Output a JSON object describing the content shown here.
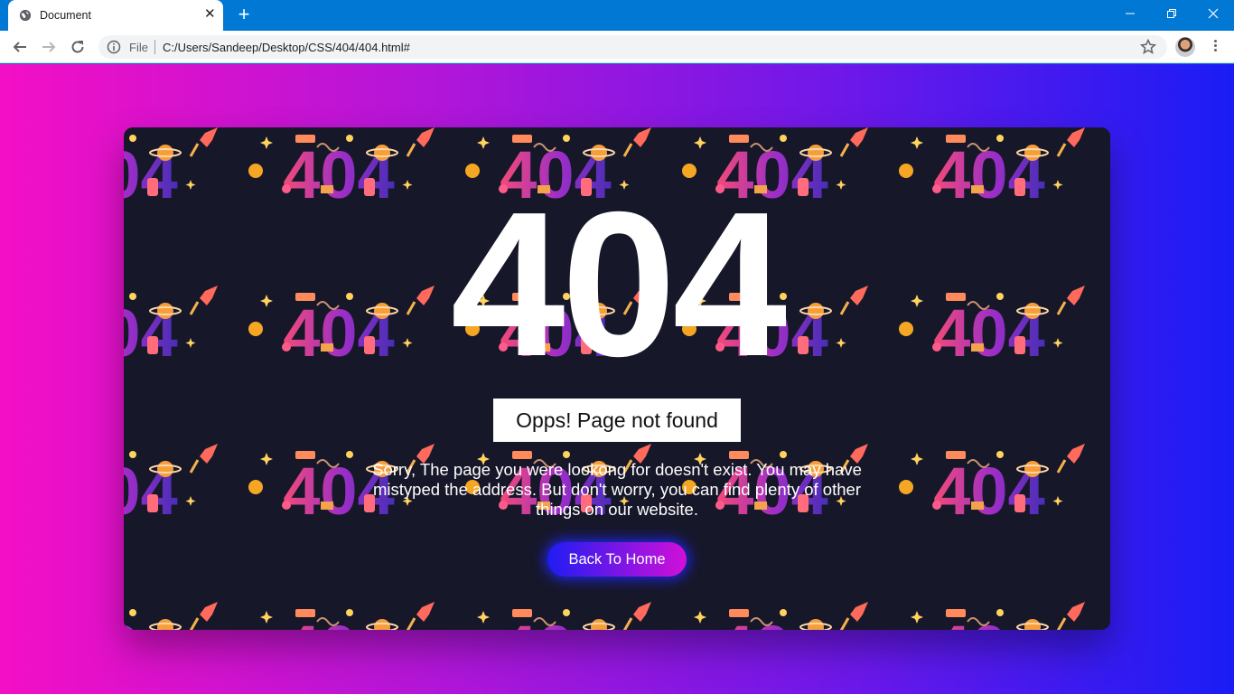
{
  "browser": {
    "tab": {
      "title": "Document"
    },
    "address_bar": {
      "scheme_label": "File",
      "url": "C:/Users/Sandeep/Desktop/CSS/404/404.html#"
    }
  },
  "page": {
    "error_code": "404",
    "subtitle": "Opps! Page not found",
    "message": "Sorry, The page you were lookong for doesn't exist. You may have mistyped the address. But don't worry, you can find plenty of other things on our website.",
    "home_button": {
      "label": "Back To Home"
    }
  },
  "colors": {
    "browser_frame": "#0078d4",
    "page_gradient_start": "#f30fc5",
    "page_gradient_end": "#1a1cf5",
    "card_background": "#17172a",
    "button_gradient_start": "#1f1cf3",
    "button_gradient_end": "#d110d8"
  },
  "icons": [
    "globe-icon",
    "close-icon",
    "plus-icon",
    "minimize-icon",
    "restore-icon",
    "window-close-icon",
    "back-arrow-icon",
    "forward-arrow-icon",
    "reload-icon",
    "info-icon",
    "star-icon",
    "avatar",
    "kebab-menu-icon"
  ]
}
